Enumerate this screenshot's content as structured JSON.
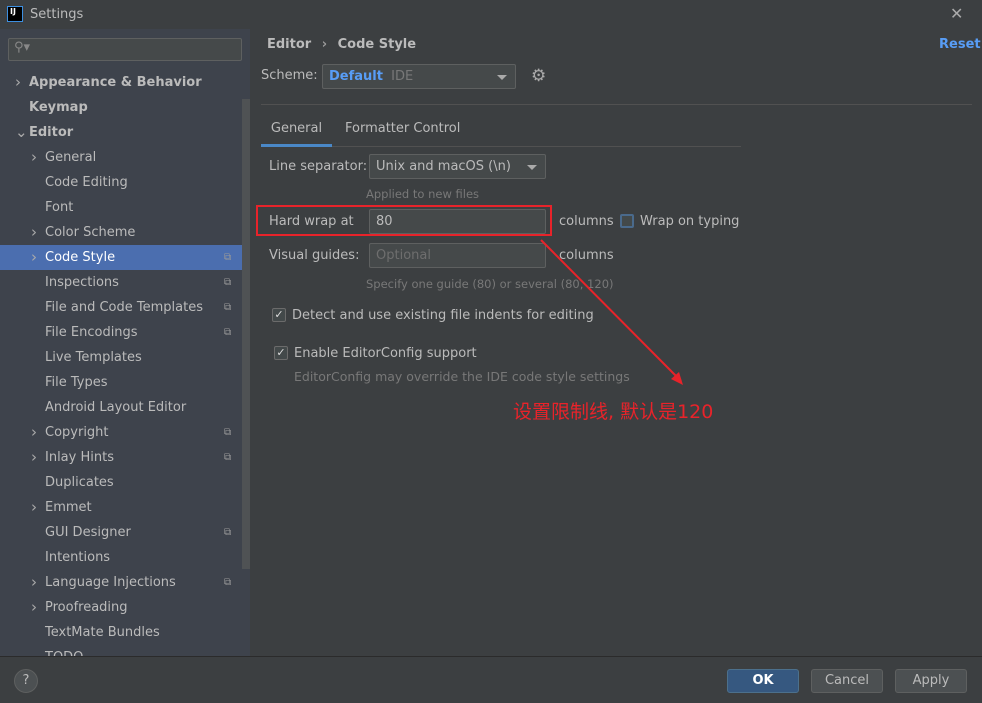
{
  "window": {
    "title": "Settings",
    "app_icon": "IJ"
  },
  "sidebar": {
    "search_placeholder": "",
    "items": [
      {
        "label": "Appearance & Behavior",
        "arrow": ">",
        "bold": true,
        "level": 0
      },
      {
        "label": "Keymap",
        "arrow": "",
        "bold": true,
        "level": 0
      },
      {
        "label": "Editor",
        "arrow": "v",
        "bold": true,
        "level": 0
      },
      {
        "label": "General",
        "arrow": ">",
        "level": 1
      },
      {
        "label": "Code Editing",
        "arrow": "",
        "level": 1
      },
      {
        "label": "Font",
        "arrow": "",
        "level": 1
      },
      {
        "label": "Color Scheme",
        "arrow": ">",
        "level": 1
      },
      {
        "label": "Code Style",
        "arrow": ">",
        "level": 1,
        "selected": true,
        "copy": true
      },
      {
        "label": "Inspections",
        "arrow": "",
        "level": 1,
        "copy": true
      },
      {
        "label": "File and Code Templates",
        "arrow": "",
        "level": 1,
        "copy": true
      },
      {
        "label": "File Encodings",
        "arrow": "",
        "level": 1,
        "copy": true
      },
      {
        "label": "Live Templates",
        "arrow": "",
        "level": 1
      },
      {
        "label": "File Types",
        "arrow": "",
        "level": 1
      },
      {
        "label": "Android Layout Editor",
        "arrow": "",
        "level": 1
      },
      {
        "label": "Copyright",
        "arrow": ">",
        "level": 1,
        "copy": true
      },
      {
        "label": "Inlay Hints",
        "arrow": ">",
        "level": 1,
        "copy": true
      },
      {
        "label": "Duplicates",
        "arrow": "",
        "level": 1
      },
      {
        "label": "Emmet",
        "arrow": ">",
        "level": 1
      },
      {
        "label": "GUI Designer",
        "arrow": "",
        "level": 1,
        "copy": true
      },
      {
        "label": "Intentions",
        "arrow": "",
        "level": 1
      },
      {
        "label": "Language Injections",
        "arrow": ">",
        "level": 1,
        "copy": true
      },
      {
        "label": "Proofreading",
        "arrow": ">",
        "level": 1
      },
      {
        "label": "TextMate Bundles",
        "arrow": "",
        "level": 1
      },
      {
        "label": "TODO",
        "arrow": "",
        "level": 1
      }
    ]
  },
  "breadcrumb": {
    "parent": "Editor",
    "sep": "›",
    "current": "Code Style"
  },
  "reset_label": "Reset",
  "scheme": {
    "label": "Scheme:",
    "name": "Default",
    "scope": "IDE"
  },
  "tabs": [
    {
      "label": "General",
      "active": true
    },
    {
      "label": "Formatter Control"
    }
  ],
  "form": {
    "line_separator": {
      "label": "Line separator:",
      "value": "Unix and macOS (\\n)",
      "hint": "Applied to new files"
    },
    "hard_wrap": {
      "label": "Hard wrap at",
      "value": "80",
      "unit": "columns"
    },
    "wrap_on_typing": {
      "label": "Wrap on typing",
      "checked": false
    },
    "visual_guides": {
      "label": "Visual guides:",
      "placeholder": "Optional",
      "unit": "columns",
      "hint": "Specify one guide (80) or several (80, 120)"
    },
    "detect_indents": {
      "label": "Detect and use existing file indents for editing",
      "checked": true
    },
    "editorconfig": {
      "label": "Enable EditorConfig support",
      "checked": true,
      "hint": "EditorConfig may override the IDE code style settings"
    }
  },
  "annotation": {
    "text": "设置限制线, 默认是120",
    "color": "#e8232a"
  },
  "footer": {
    "help": "?",
    "ok": "OK",
    "cancel": "Cancel",
    "apply": "Apply"
  }
}
